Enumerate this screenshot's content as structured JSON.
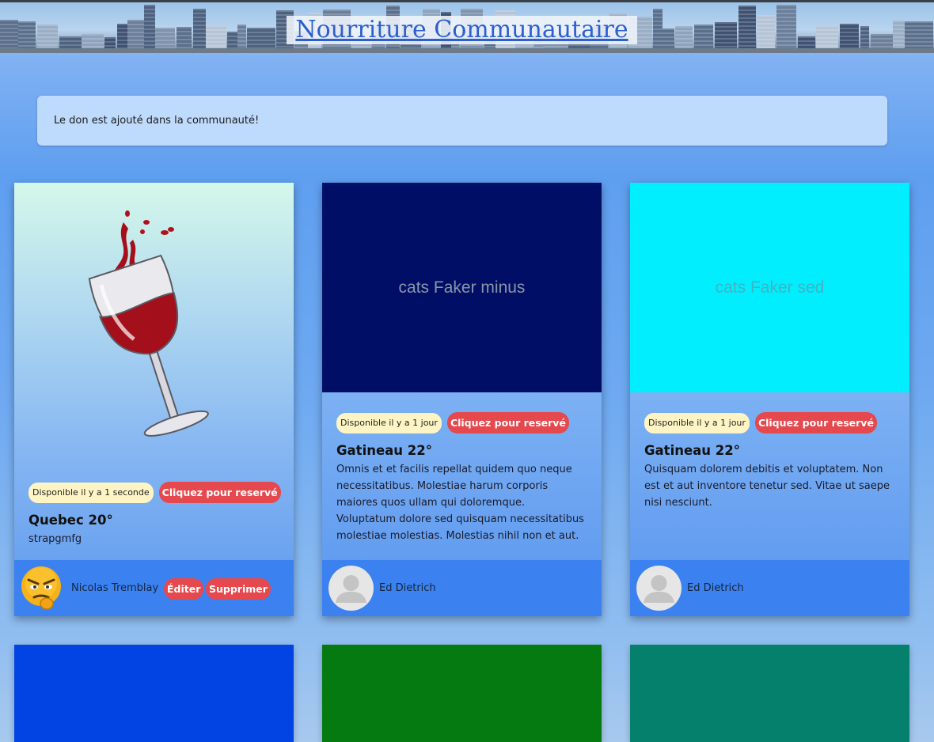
{
  "header": {
    "title": "Nourriture Communautaire"
  },
  "alert": {
    "message": "Le don est ajouté dans la communauté!"
  },
  "cards": [
    {
      "image_color": "#d4f8ea",
      "image_icon": "wine-glass",
      "availability": "Disponible il y a 1 seconde",
      "reserve_label": "Cliquez pour reservé",
      "title": "Quebec 20°",
      "description": "strapgmfg",
      "author": "Nicolas Tremblay",
      "avatar_icon": "angry-emoji",
      "edit_label": "Éditer",
      "delete_label": "Supprimer"
    },
    {
      "image_color": "#000e66",
      "image_text": "cats Faker minus",
      "image_text_color": "#8a95a8",
      "availability": "Disponible il y a 1 jour",
      "reserve_label": "Cliquez pour reservé",
      "title": "Gatineau 22°",
      "description": "Omnis et et facilis repellat quidem quo neque necessitatibus. Molestiae harum corporis maiores quos ullam qui doloremque. Voluptatum dolore sed quisquam necessitatibus molestiae molestias. Molestias nihil non et aut.",
      "author": "Ed Dietrich",
      "avatar_icon": "default-user"
    },
    {
      "image_color": "#00eefe",
      "image_text": "cats Faker sed",
      "image_text_color": "#3fb4c4",
      "availability": "Disponible il y a 1 jour",
      "reserve_label": "Cliquez pour reservé",
      "title": "Gatineau 22°",
      "description": "Quisquam dolorem debitis et voluptatem. Non est et aut inventore tenetur sed. Vitae ut saepe nisi nesciunt.",
      "author": "Ed Dietrich",
      "avatar_icon": "default-user"
    }
  ],
  "bottom_cards": [
    {
      "image_color": "#0243e4"
    },
    {
      "image_color": "#047a11"
    },
    {
      "image_color": "#05806c"
    }
  ]
}
